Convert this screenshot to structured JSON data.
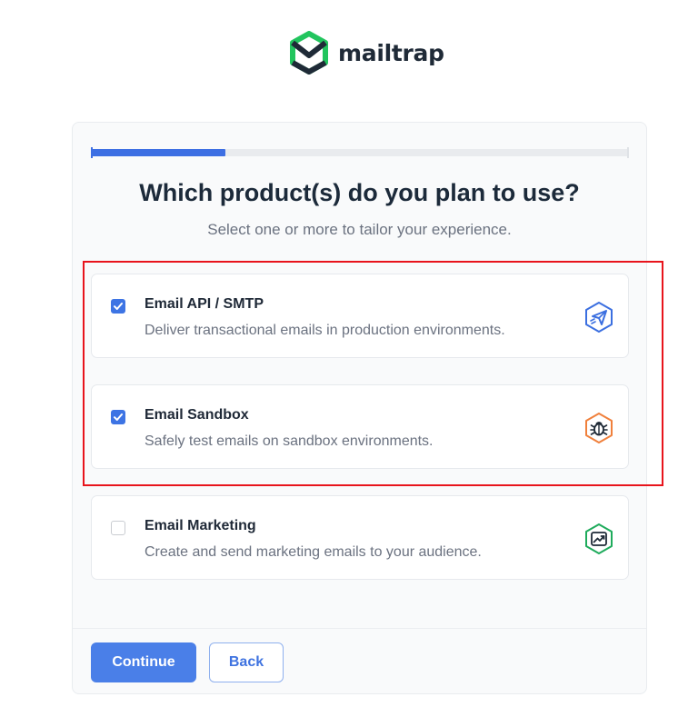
{
  "brand": {
    "name": "mailtrap",
    "color": "#22c55e"
  },
  "progress": {
    "fraction": 0.25,
    "color": "#3d6fe3"
  },
  "heading": {
    "title": "Which product(s) do you plan to use?",
    "subtitle": "Select one or more to tailor your experience."
  },
  "options": [
    {
      "title": "Email API / SMTP",
      "description": "Deliver transactional emails in production environments.",
      "checked": true,
      "icon": "send-icon",
      "icon_color": "#3b6fe0"
    },
    {
      "title": "Email Sandbox",
      "description": "Safely test emails on sandbox environments.",
      "checked": true,
      "icon": "bug-icon",
      "icon_color": "#f0803c"
    },
    {
      "title": "Email Marketing",
      "description": "Create and send marketing emails to your audience.",
      "checked": false,
      "icon": "trend-chart-icon",
      "icon_color": "#1fab5c"
    }
  ],
  "actions": {
    "continue_label": "Continue",
    "back_label": "Back"
  },
  "annotation": {
    "highlight_color": "#e8141c"
  }
}
